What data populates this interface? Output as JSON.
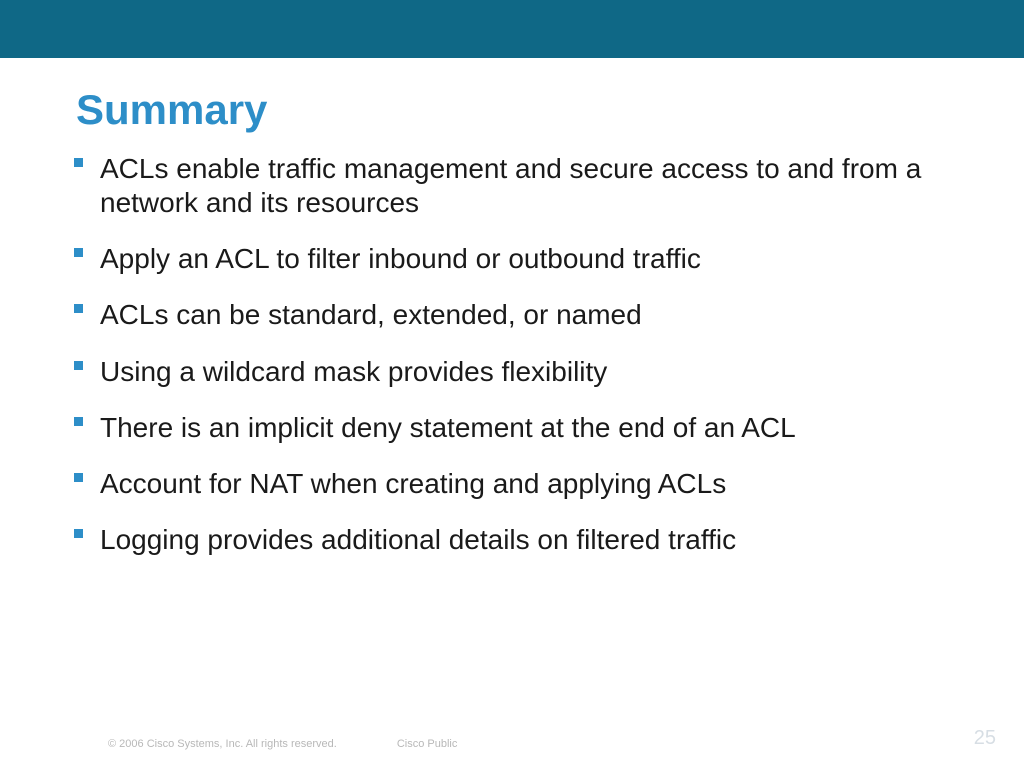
{
  "title": "Summary",
  "bullets": [
    "ACLs enable traffic management and secure access to and from a network and its resources",
    "Apply an ACL to filter inbound or outbound traffic",
    "ACLs can be standard, extended, or named",
    "Using a wildcard mask provides flexibility",
    "There is an implicit deny statement at the end of an ACL",
    "Account for NAT when creating and applying ACLs",
    "Logging provides additional details on filtered traffic"
  ],
  "footer": {
    "copyright": "© 2006 Cisco Systems, Inc. All rights reserved.",
    "label": "Cisco Public",
    "page": "25"
  }
}
